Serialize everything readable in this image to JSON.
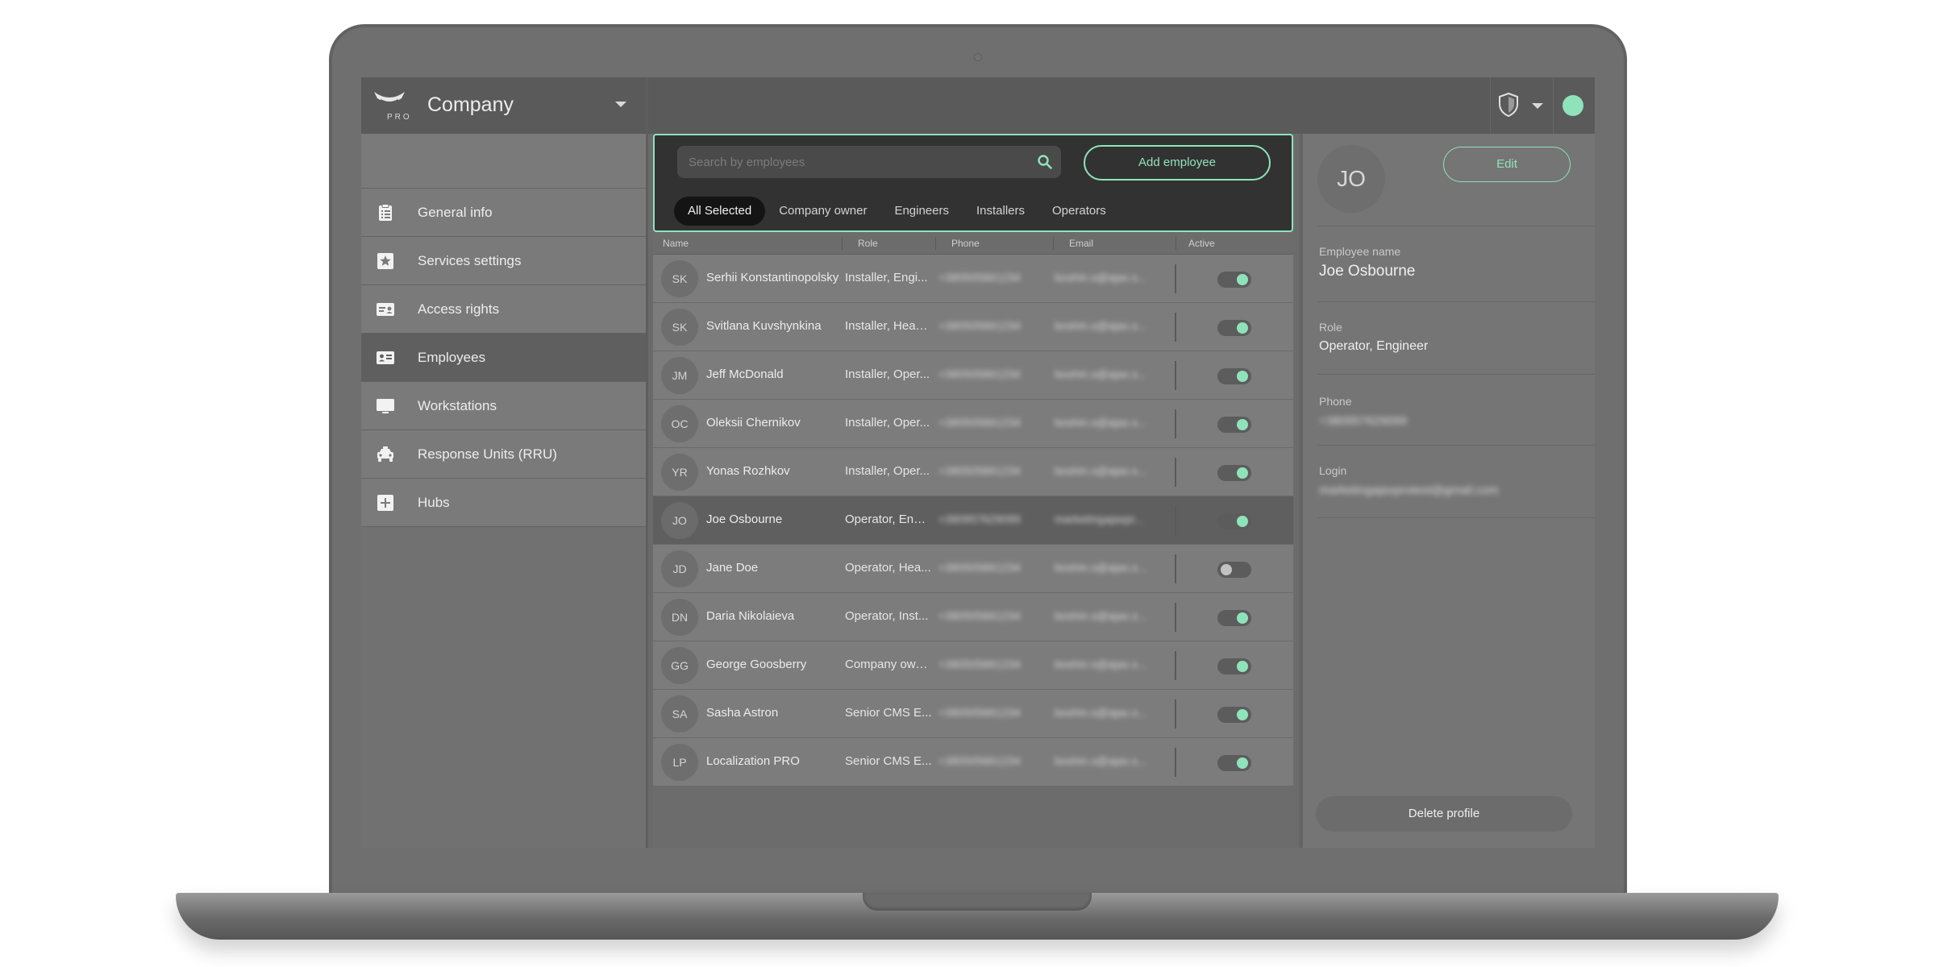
{
  "brand": {
    "logo_text": "PRO",
    "company": "Company"
  },
  "sidebar": {
    "items": [
      {
        "label": "General info",
        "icon": "clipboard-icon"
      },
      {
        "label": "Services settings",
        "icon": "star-icon"
      },
      {
        "label": "Access rights",
        "icon": "id-card-icon"
      },
      {
        "label": "Employees",
        "icon": "contact-card-icon"
      },
      {
        "label": "Workstations",
        "icon": "monitor-icon"
      },
      {
        "label": "Response Units (RRU)",
        "icon": "car-icon"
      },
      {
        "label": "Hubs",
        "icon": "plus-square-icon"
      }
    ],
    "active": "Employees"
  },
  "search": {
    "placeholder": "Search by employees"
  },
  "add_employee": "Add employee",
  "filters": [
    "All Selected",
    "Company owner",
    "Engineers",
    "Installers",
    "Operators"
  ],
  "table": {
    "headers": {
      "name": "Name",
      "role": "Role",
      "phone": "Phone",
      "email": "Email",
      "active": "Active"
    },
    "rows": [
      {
        "initials": "SK",
        "name": "Serhii Konstantinopolsky",
        "role": "Installer, Engi...",
        "phone": "+380505661234",
        "email": "boshin.s@ajax.s...",
        "active": true
      },
      {
        "initials": "SK",
        "name": "Svitlana Kuvshynkina",
        "role": "Installer, Head...",
        "phone": "+380505661234",
        "email": "boshin.s@ajax.s...",
        "active": true
      },
      {
        "initials": "JM",
        "name": "Jeff McDonald",
        "role": "Installer, Oper...",
        "phone": "+380505661234",
        "email": "boshin.s@ajax.s...",
        "active": true
      },
      {
        "initials": "OC",
        "name": "Oleksii Chernikov",
        "role": "Installer, Oper...",
        "phone": "+380505661234",
        "email": "boshin.s@ajax.s...",
        "active": true
      },
      {
        "initials": "YR",
        "name": "Yonas Rozhkov",
        "role": "Installer, Oper...",
        "phone": "+380505661234",
        "email": "boshin.s@ajax.s...",
        "active": true
      },
      {
        "initials": "JO",
        "name": "Joe Osbourne",
        "role": "Operator, Engi...",
        "phone": "+380957629099",
        "email": "marketingajaxpr...",
        "active": true
      },
      {
        "initials": "JD",
        "name": "Jane Doe",
        "role": "Operator, Hea...",
        "phone": "+380505661234",
        "email": "boshin.s@ajax.s...",
        "active": false
      },
      {
        "initials": "DN",
        "name": "Daria Nikolaieva",
        "role": "Operator, Inst...",
        "phone": "+380505661234",
        "email": "boshin.s@ajax.s...",
        "active": true
      },
      {
        "initials": "GG",
        "name": "George Goosberry",
        "role": "Company own...",
        "phone": "+380505661234",
        "email": "boshin.s@ajax.s...",
        "active": true
      },
      {
        "initials": "SA",
        "name": "Sasha Astron",
        "role": "Senior CMS E...",
        "phone": "+380505661234",
        "email": "boshin.s@ajax.s...",
        "active": true
      },
      {
        "initials": "LP",
        "name": "Localization PRO",
        "role": "Senior CMS E...",
        "phone": "+380505661234",
        "email": "boshin.s@ajax.s...",
        "active": true
      }
    ],
    "selected_index": 5
  },
  "detail": {
    "initials": "JO",
    "edit": "Edit",
    "name_label": "Employee name",
    "name": "Joe Osbourne",
    "role_label": "Role",
    "role": "Operator, Engineer",
    "phone_label": "Phone",
    "phone": "+380957629099",
    "login_label": "Login",
    "login": "marketingajaxprotest@gmail.com",
    "delete": "Delete profile"
  },
  "colors": {
    "accent": "#8fe3bb",
    "panel_dark": "#323232",
    "row": "#7c7c7c",
    "row_selected": "#5f5f5f"
  }
}
